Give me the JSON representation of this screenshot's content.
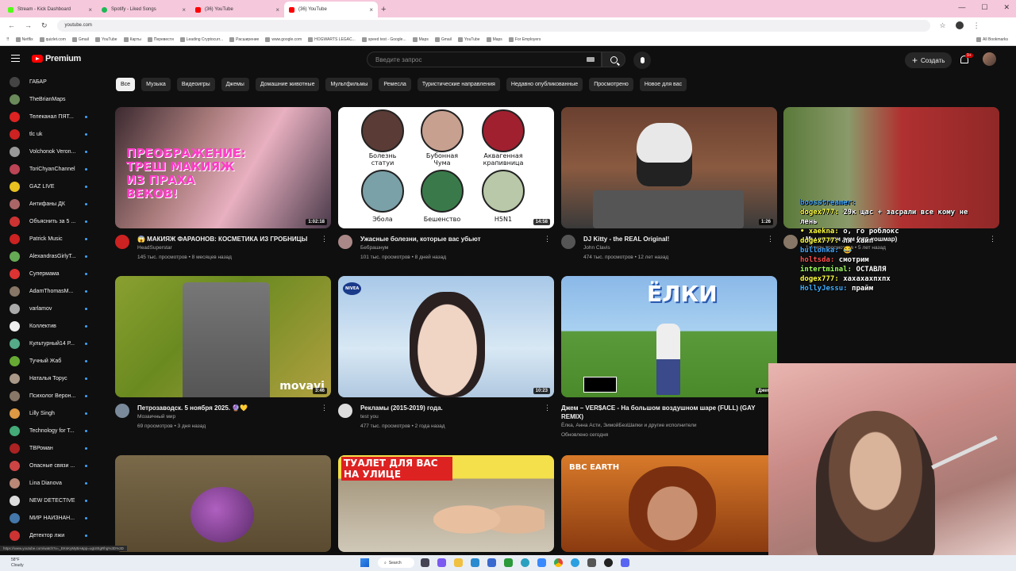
{
  "browser": {
    "tabs": [
      {
        "label": "Stream - Kick Dashboard",
        "color": "#53fc18"
      },
      {
        "label": "Spotify - Liked Songs",
        "color": "#1db954"
      },
      {
        "label": "(36) YouTube",
        "color": "#ff0000"
      },
      {
        "label": "(36) YouTube",
        "color": "#ff0000"
      }
    ],
    "url": "youtube.com",
    "bookmarks": [
      "Netflix",
      "quizlet.com",
      "Gmail",
      "YouTube",
      "Карты",
      "Перевести",
      "Leading Cryptocurr...",
      "Расширение",
      "www.google.com",
      "HOGWARTS LEGAC...",
      "speed test - Google...",
      "Maps",
      "Gmail",
      "YouTube",
      "Maps",
      "For Employers"
    ],
    "all_bookmarks": "All Bookmarks"
  },
  "header": {
    "logo_text": "Premium",
    "search_placeholder": "Введите запрос",
    "create_label": "Создать",
    "notif_count": "9+"
  },
  "sidebar": {
    "items": [
      {
        "label": "ГАБАР",
        "color": "#444",
        "dot": false
      },
      {
        "label": "TheBrianMaps",
        "color": "#6a8a5a",
        "dot": false
      },
      {
        "label": "Телеканал ПЯТ...",
        "color": "#d22",
        "dot": true
      },
      {
        "label": "tlc uk",
        "color": "#c22",
        "dot": true
      },
      {
        "label": "Volchonok Veron...",
        "color": "#999",
        "dot": true
      },
      {
        "label": "ToriChyanChannel",
        "color": "#b45",
        "dot": true
      },
      {
        "label": "GAZ LIVE",
        "color": "#e8c020",
        "dot": true
      },
      {
        "label": "Антифаны ДК",
        "color": "#a66",
        "dot": true
      },
      {
        "label": "Объяснить за 5 ...",
        "color": "#c33",
        "dot": true
      },
      {
        "label": "Patrick Music",
        "color": "#c22",
        "dot": true
      },
      {
        "label": "AlexandrasGirlyT...",
        "color": "#6a5",
        "dot": true
      },
      {
        "label": "Супермама",
        "color": "#d33",
        "dot": true
      },
      {
        "label": "AdamThomasM...",
        "color": "#876",
        "dot": true
      },
      {
        "label": "varlamov",
        "color": "#aaa",
        "dot": true
      },
      {
        "label": "Коллектив",
        "color": "#eee",
        "dot": true
      },
      {
        "label": "Культурный14 Р...",
        "color": "#5a8",
        "dot": true
      },
      {
        "label": "Тучный Жаб",
        "color": "#6a3",
        "dot": true
      },
      {
        "label": "Наталья Торус",
        "color": "#a98",
        "dot": true
      },
      {
        "label": "Психолог Верон...",
        "color": "#876",
        "dot": true
      },
      {
        "label": "Lilly Singh",
        "color": "#d94",
        "dot": true
      },
      {
        "label": "Technology for T...",
        "color": "#4a7",
        "dot": true
      },
      {
        "label": "ТВРоман",
        "color": "#a22",
        "dot": true
      },
      {
        "label": "Опасные связи ...",
        "color": "#c44",
        "dot": true
      },
      {
        "label": "Lina Dianova",
        "color": "#b87",
        "dot": true
      },
      {
        "label": "NEW DETECTIVE",
        "color": "#ddd",
        "dot": true
      },
      {
        "label": "МИР НАИЗНАН...",
        "color": "#47a",
        "dot": true
      },
      {
        "label": "Детектор лжи",
        "color": "#c33",
        "dot": true
      }
    ]
  },
  "chips": [
    "Все",
    "Музыка",
    "Видеоигры",
    "Джемы",
    "Домашние животные",
    "Мультфильмы",
    "Ремесла",
    "Туристические направления",
    "Недавно опубликованные",
    "Просмотрено",
    "Новое для вас"
  ],
  "videos": [
    {
      "title": "😱 МАКИЯЖ ФАРАОНОВ: КОСМЕТИКА ИЗ ГРОБНИЦЫ",
      "channel": "HeadSuperstar",
      "stats": "145 тыс. просмотров • 8 месяцев назад",
      "duration": "1:02:18",
      "thumb_text": "ПРЕОБРАЖЕНИЕ: ТРЕШ МАКИЯЖ ИЗ ПРАХА ВЕКОВ!"
    },
    {
      "title": "Ужасные болезни, которые вас убьют",
      "channel": "Бебрашнум",
      "stats": "101 тыс. просмотров • 8 дней назад",
      "duration": "14:58",
      "thumb_labels": [
        "Болезнь статуи",
        "Бубонная Чума",
        "Аквагенная крапивница",
        "Эбола",
        "Бешенство",
        "H5N1"
      ]
    },
    {
      "title": "DJ Kitty - the REAL Original!",
      "channel": "John Clavis",
      "stats": "474 тыс. просмотров • 12 лет назад",
      "duration": "1:26"
    },
    {
      "title": "Мы купили дом (это кошмар)",
      "channel": "",
      "stats": "1,4 млн просмотров • 5 лет назад",
      "duration": ""
    },
    {
      "title": "Петрозаводск. 5 ноября 2025. 🔮💛",
      "channel": "Мозаичный мир",
      "stats": "69 просмотров • 3 дня назад",
      "duration": "3:46",
      "thumb_text": "movavi"
    },
    {
      "title": "Рекламы (2015-2019) года.",
      "channel": "test you",
      "stats": "477 тыс. просмотров • 2 года назад",
      "duration": "10:23",
      "thumb_text": "NIVEA"
    },
    {
      "title": "Джем – VER$ACE - На большом воздушном шаре (FULL) (GAY REMIX)",
      "channel": "Ёлка, Анна Асти, ЗимойБезШапки и другие исполнители",
      "stats": "Обновлено сегодня",
      "duration": "Джем",
      "thumb_text": "ЁЛКИ"
    },
    {
      "title": "",
      "channel": "",
      "stats": "",
      "duration": "",
      "thumb_text": ""
    },
    {
      "title": "",
      "channel": "",
      "stats": "",
      "duration": "",
      "thumb_text": "ТУАЛЕТ ДЛЯ ВАС НА УЛИЦЕ"
    },
    {
      "title": "",
      "channel": "",
      "stats": "",
      "duration": "",
      "thumb_text": "BBC EARTH"
    }
  ],
  "chat": [
    {
      "user": "boosstreamer:",
      "msg": "",
      "color": "#3ea6ff"
    },
    {
      "user": "dogex777:",
      "msg": "29к щас + засрали все кому не",
      "color": "#ffff40"
    },
    {
      "user": "",
      "msg": "лень",
      "color": "#fff"
    },
    {
      "user": "",
      "msg": "",
      "color": "#ff4040"
    },
    {
      "user": "• xaekna:",
      "msg": "о, го роблокс",
      "color": "#ffff40"
    },
    {
      "user": "dogex777:",
      "msg": "ля хайп",
      "color": "#ffff40"
    },
    {
      "user": "bullonka:",
      "msg": "😂",
      "color": "#3ea6ff"
    },
    {
      "user": "holtsda:",
      "msg": "смотрим",
      "color": "#ff5050"
    },
    {
      "user": "intertminal:",
      "msg": "ОСТАВЛЯ",
      "color": "#a0ff60"
    },
    {
      "user": "dogex777:",
      "msg": "хахахахпхпх",
      "color": "#ffff40"
    },
    {
      "user": "HollyJessu:",
      "msg": "прайм",
      "color": "#40b0ff"
    }
  ],
  "taskbar": {
    "weather_temp": "58°F",
    "weather_desc": "Cloudy",
    "search_label": "Search"
  },
  "status_url": "https://www.youtube.com/watch?v=_EKsKyMyBA&pp=ugUIEgRhg%3D%3D"
}
